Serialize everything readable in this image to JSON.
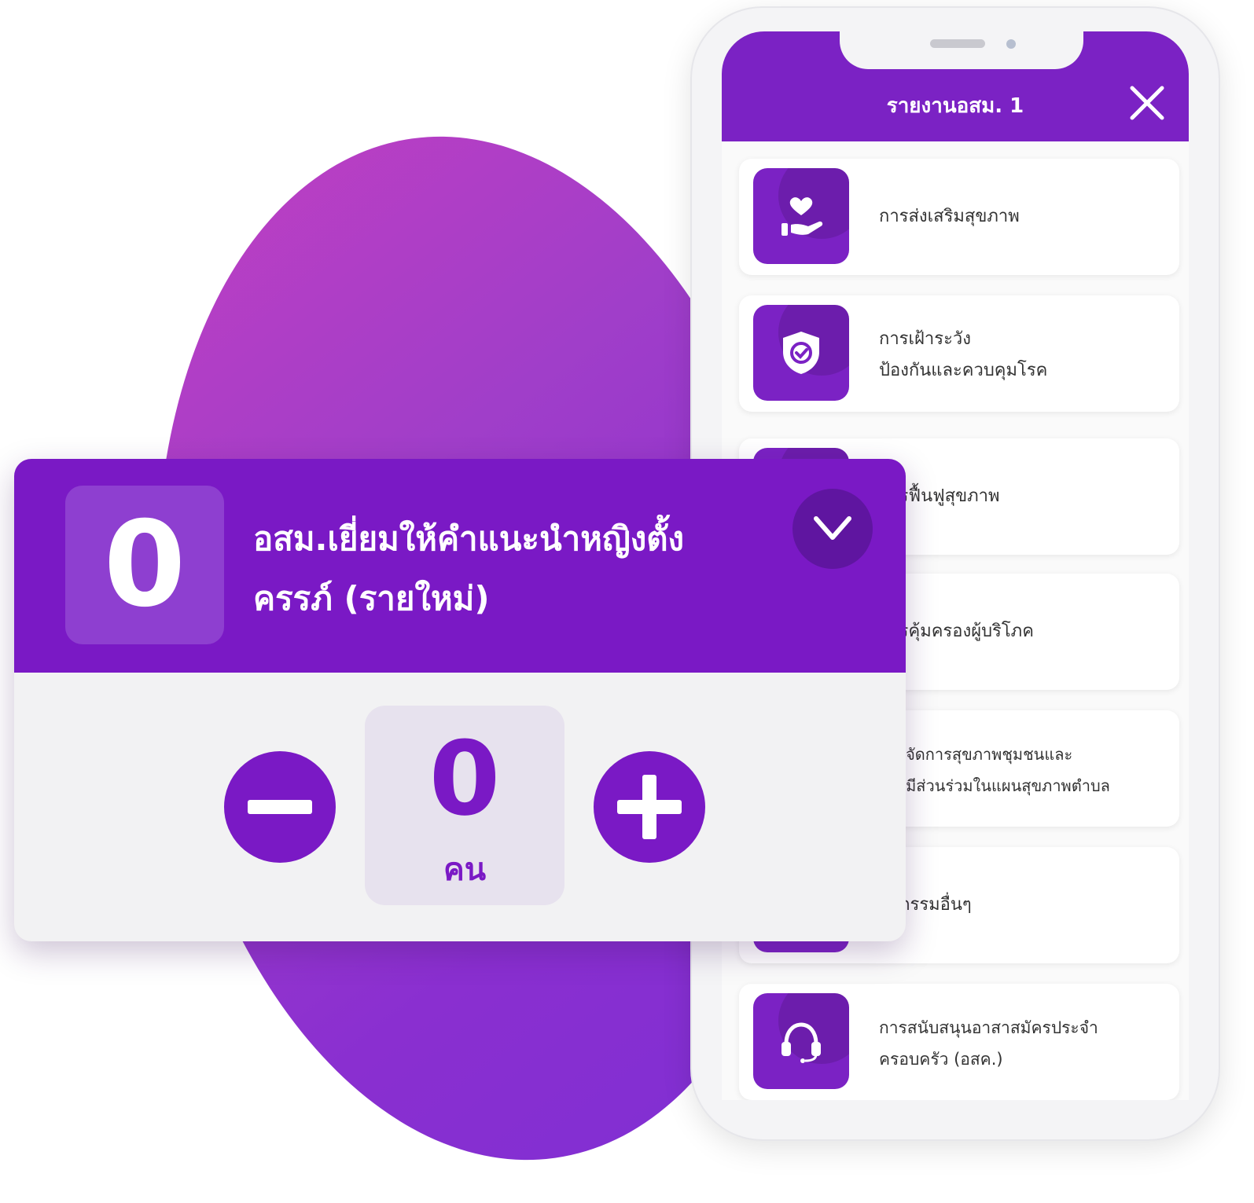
{
  "phone": {
    "title": "รายงานอสม. 1",
    "items": [
      {
        "label": "การส่งเสริมสุขภาพ",
        "icon": "heart-hand-icon"
      },
      {
        "label": "การเฝ้าระวัง\nป้องกันและควบคุมโรค",
        "icon": "shield-check-icon"
      },
      {
        "label": "การฟื้นฟูสุขภาพ",
        "icon": "rehab-icon"
      },
      {
        "label": "การคุ้มครองผู้บริโภค",
        "icon": "consumer-icon"
      },
      {
        "label": "การจัดการสุขภาพชุมชนและ\nการมีส่วนร่วมในแผนสุขภาพตำบล",
        "icon": "community-icon"
      },
      {
        "label": "กิจกรรมอื่นๆ",
        "icon": "activity-icon"
      },
      {
        "label": "การสนับสนุนอาสาสมัครประจำ\nครอบครัว (อสค.)",
        "icon": "headset-icon"
      }
    ]
  },
  "card": {
    "count": "0",
    "title": "อสม.เยี่ยมให้คำแนะนำหญิงตั้งครรภ์ (รายใหม่)",
    "value": "0",
    "unit": "คน"
  },
  "colors": {
    "primary": "#7a19c5",
    "header": "#7b22c4",
    "blob_start": "#c13fc2",
    "blob_end": "#7f2fd3"
  }
}
